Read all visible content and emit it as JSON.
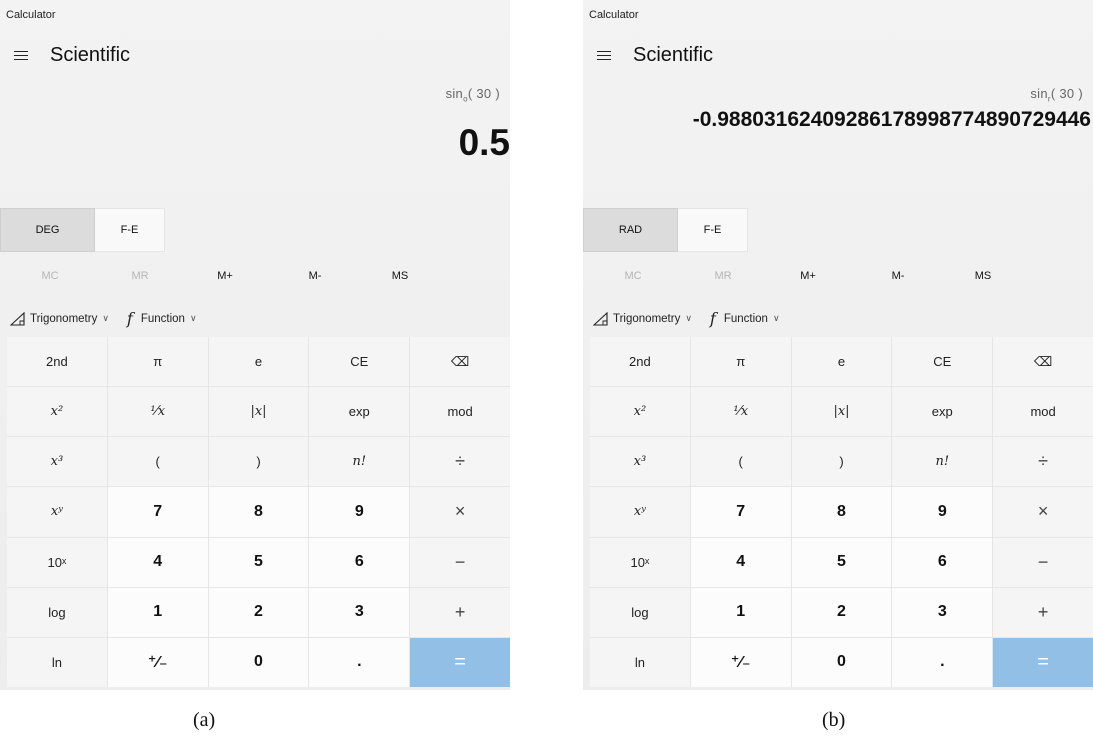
{
  "panels": [
    {
      "app_title": "Calculator",
      "mode": "Scientific",
      "expression_fn": "sin",
      "expression_sub": "o",
      "expression_arg": "( 30 )",
      "result": "0.5",
      "angle_unit": "DEG",
      "fe_label": "F-E",
      "caption": "(a)"
    },
    {
      "app_title": "Calculator",
      "mode": "Scientific",
      "expression_fn": "sin",
      "expression_sub": "r",
      "expression_arg": "( 30 )",
      "result": "-0.98803162409286178998774890729446",
      "angle_unit": "RAD",
      "fe_label": "F-E",
      "caption": "(b)"
    }
  ],
  "memory": [
    {
      "label": "MC",
      "enabled": false
    },
    {
      "label": "MR",
      "enabled": false
    },
    {
      "label": "M+",
      "enabled": true
    },
    {
      "label": "M-",
      "enabled": true
    },
    {
      "label": "MS",
      "enabled": true
    }
  ],
  "menus": {
    "trigonometry": "Trigonometry",
    "function": "Function",
    "trig_icon": "triangle-ruler-icon",
    "func_icon": "function-f-icon",
    "func_symbol": "f",
    "chevron": "∨"
  },
  "keys": [
    [
      "2nd",
      "π",
      "e",
      "CE",
      "⌫"
    ],
    [
      "x²",
      "¹⁄x",
      "|x|",
      "exp",
      "mod"
    ],
    [
      "x³",
      "(",
      ")",
      "n!",
      "÷"
    ],
    [
      "xʸ",
      "7",
      "8",
      "9",
      "×"
    ],
    [
      "10ˣ",
      "4",
      "5",
      "6",
      "−"
    ],
    [
      "log",
      "1",
      "2",
      "3",
      "+"
    ],
    [
      "ln",
      "⁺∕₋",
      "0",
      ".",
      "="
    ]
  ],
  "colors": {
    "equals": "#91bfe6",
    "angle_button": "#dcdcdc"
  }
}
